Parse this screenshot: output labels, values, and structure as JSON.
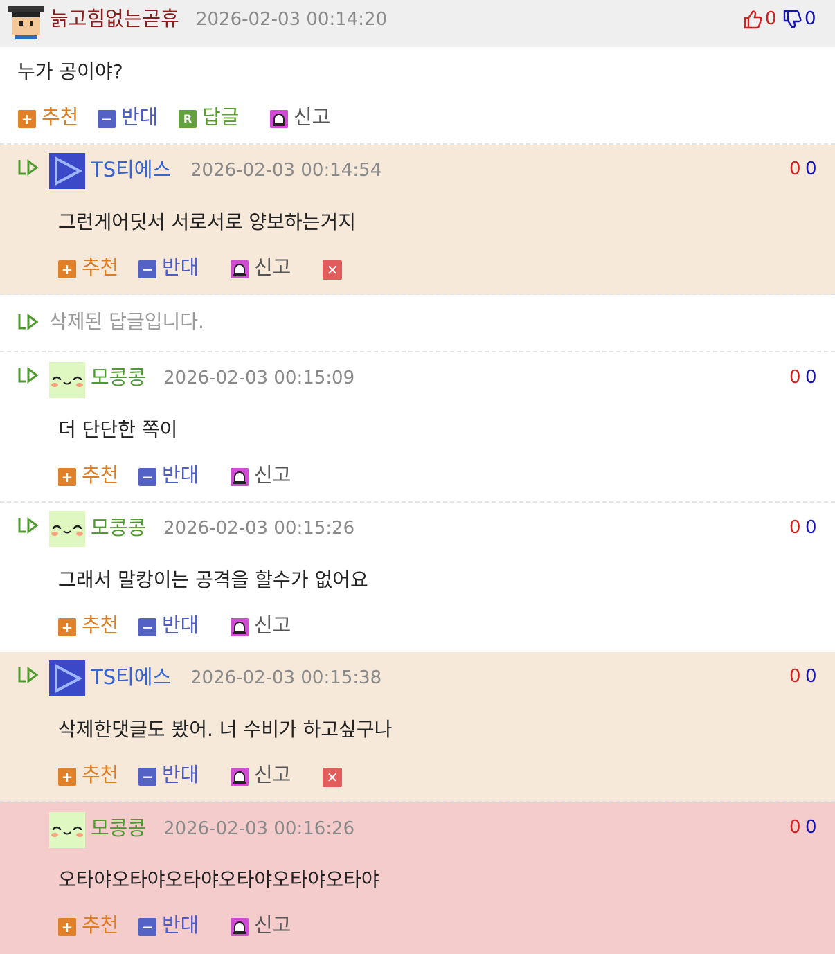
{
  "main_comment": {
    "nick": "늙고힘없는곧휴",
    "date": "2026-02-03 00:14:20",
    "likes": "0",
    "dislikes": "0",
    "text": "누가 공이야?",
    "actions": {
      "recommend": "추천",
      "oppose": "반대",
      "reply": "답글",
      "report": "신고"
    }
  },
  "replies": [
    {
      "nick": "TS티에스",
      "date": "2026-02-03 00:14:54",
      "up": "0",
      "down": "0",
      "text": "그런게어딧서 서로서로 양보하는거지"
    },
    {
      "deleted_text": "삭제된 답글입니다."
    },
    {
      "nick": "모콩콩",
      "date": "2026-02-03 00:15:09",
      "up": "0",
      "down": "0",
      "text": "더 단단한 쪽이"
    },
    {
      "nick": "모콩콩",
      "date": "2026-02-03 00:15:26",
      "up": "0",
      "down": "0",
      "text": "그래서 말캉이는 공격을 할수가 없어요"
    },
    {
      "nick": "TS티에스",
      "date": "2026-02-03 00:15:38",
      "up": "0",
      "down": "0",
      "text": "삭제한댓글도 봤어. 너 수비가 하고싶구나"
    },
    {
      "nick": "모콩콩",
      "date": "2026-02-03 00:16:26",
      "up": "0",
      "down": "0",
      "text": "오타야오타야오타야오타야오타야오타야"
    }
  ],
  "actions": {
    "recommend": "추천",
    "oppose": "반대",
    "report": "신고"
  },
  "icons": {
    "thumbs_up": "thumbs-up-icon",
    "thumbs_down": "thumbs-down-icon",
    "reply_arrow": "reply-arrow-icon",
    "report": "siren-icon",
    "delete": "close-icon"
  },
  "colors": {
    "header_bg": "#efefef",
    "reply_bg": "#f7e9da",
    "highlight_bg": "#f5cccc",
    "recommend": "#e0812a",
    "oppose": "#5362c4",
    "reply": "#62a13d",
    "report": "#d14bd4",
    "delete": "#e35c5c"
  }
}
